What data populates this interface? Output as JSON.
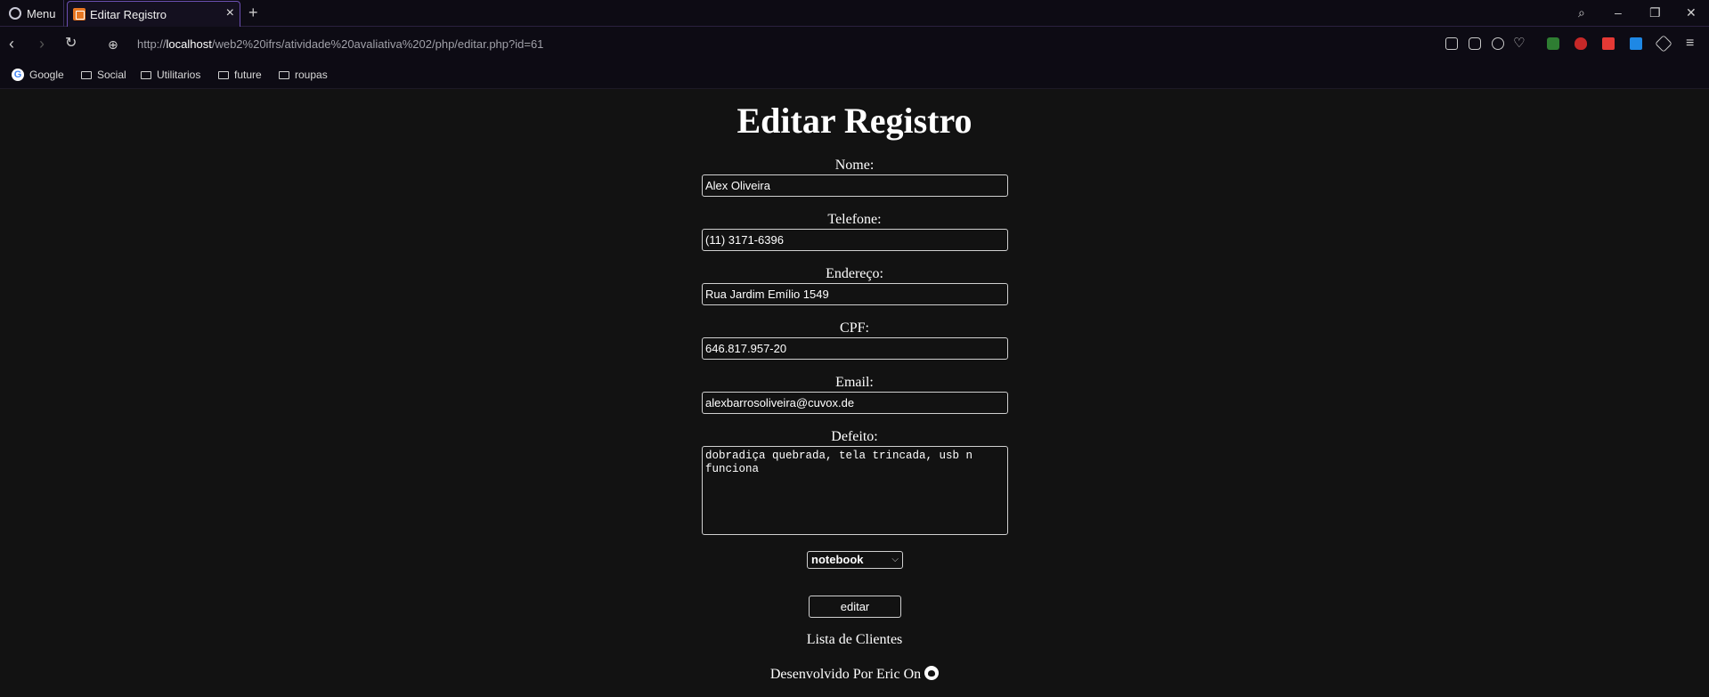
{
  "browser": {
    "menu_label": "Menu",
    "tab_title": "Editar Registro",
    "url_prefix": "http://",
    "url_host": "localhost",
    "url_path": "/web2%20ifrs/atividade%20avaliativa%202/php/editar.php?id=61",
    "bookmarks": [
      "Google",
      "Social",
      "Utilitarios",
      "future",
      "roupas"
    ]
  },
  "page": {
    "title": "Editar Registro",
    "fields": {
      "nome": {
        "label": "Nome:",
        "value": "Alex Oliveira"
      },
      "telefone": {
        "label": "Telefone:",
        "value": "(11) 3171-6396"
      },
      "endereco": {
        "label": "Endereço:",
        "value": "Rua Jardim Emílio 1549"
      },
      "cpf": {
        "label": "CPF:",
        "value": "646.817.957-20"
      },
      "email": {
        "label": "Email:",
        "value": "alexbarrosoliveira@cuvox.de"
      },
      "defeito": {
        "label": "Defeito:",
        "value": "dobradiça quebrada, tela trincada, usb n funciona"
      }
    },
    "tipo_selected": "notebook",
    "submit_label": "editar",
    "list_link": "Lista de Clientes",
    "footer_text": "Desenvolvido Por Eric On"
  }
}
